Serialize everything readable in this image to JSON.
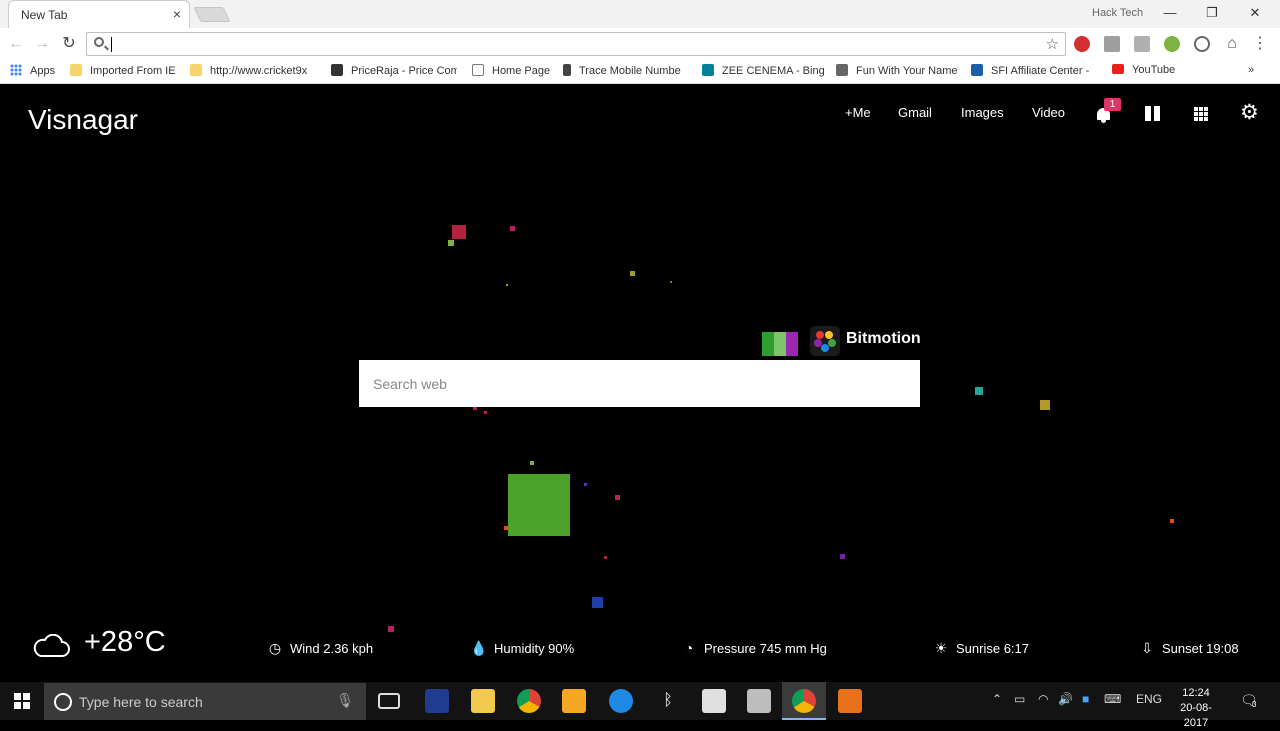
{
  "browser": {
    "tab_title": "New Tab",
    "tab_close": "×",
    "profile_name": "Hack Tech",
    "window_controls": {
      "minimize": "—",
      "restore": "❐",
      "close": "✕"
    },
    "omnibox_value": "",
    "bookmarks": [
      {
        "label": "Apps",
        "icon": "apps-grid-icon",
        "color": "#4285f4"
      },
      {
        "label": "Imported From IE",
        "icon": "folder-icon",
        "color": "#f6d46c"
      },
      {
        "label": "http://www.cricket9x",
        "icon": "folder-icon",
        "color": "#f6d46c"
      },
      {
        "label": "PriceRaja - Price Com",
        "icon": "priceraja-icon",
        "color": "#333333"
      },
      {
        "label": "Home Page",
        "icon": "page-icon",
        "color": "#ffffff"
      },
      {
        "label": "Trace Mobile Numbe",
        "icon": "phone-icon",
        "color": "#444444"
      },
      {
        "label": "ZEE CENEMA - Bing",
        "icon": "bing-icon",
        "color": "#00809d"
      },
      {
        "label": "Fun With Your Name",
        "icon": "hat-icon",
        "color": "#666666"
      },
      {
        "label": "SFI Affiliate Center -",
        "icon": "sfi-icon",
        "color": "#1a5fa8"
      },
      {
        "label": "YouTube",
        "icon": "youtube-icon",
        "color": "#e62117"
      }
    ],
    "bookmarks_overflow": "»"
  },
  "page": {
    "city": "Visnagar",
    "nav": {
      "me": "+Me",
      "gmail": "Gmail",
      "images": "Images",
      "video": "Video"
    },
    "notification_count": "1",
    "promo_name": "Bitmotion",
    "search_placeholder": "Search web",
    "weather": {
      "temperature": "+28°C",
      "wind": "Wind 2.36 kph",
      "humidity": "Humidity 90%",
      "pressure": "Pressure 745 mm Hg",
      "sunrise": "Sunrise 6:17",
      "sunset": "Sunset 19:08"
    },
    "accent_color": "#e2336b"
  },
  "taskbar": {
    "search_placeholder": "Type here to search",
    "language": "ENG",
    "time": "12:24",
    "date": "20-08-2017",
    "notification_count": "3"
  }
}
